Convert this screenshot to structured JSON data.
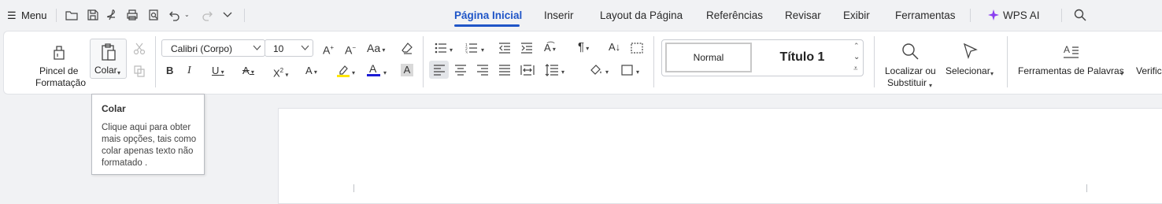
{
  "topbar": {
    "menu_label": "Menu",
    "tabs": [
      {
        "label": "Página Inicial",
        "active": true
      },
      {
        "label": "Inserir"
      },
      {
        "label": "Layout da Página"
      },
      {
        "label": "Referências"
      },
      {
        "label": "Revisar"
      },
      {
        "label": "Exibir"
      },
      {
        "label": "Ferramentas"
      }
    ],
    "wps_ai_label": "WPS AI",
    "accent_color": "#1f55c7"
  },
  "ribbon": {
    "format_painter_line1": "Pincel de",
    "format_painter_line2": "Formatação",
    "paste_label": "Colar",
    "font_name": "Calibri (Corpo)",
    "font_size": "10",
    "styles": {
      "normal": "Normal",
      "title1": "Título 1"
    },
    "find_line1": "Localizar ou",
    "find_line2": "Substituir",
    "select_label": "Selecionar",
    "word_tools_label": "Ferramentas de Palavras",
    "verify_label": "Verific"
  },
  "tooltip": {
    "title": "Colar",
    "body": "Clique aqui para obter mais opções, tais como colar apenas texto não formatado ."
  }
}
